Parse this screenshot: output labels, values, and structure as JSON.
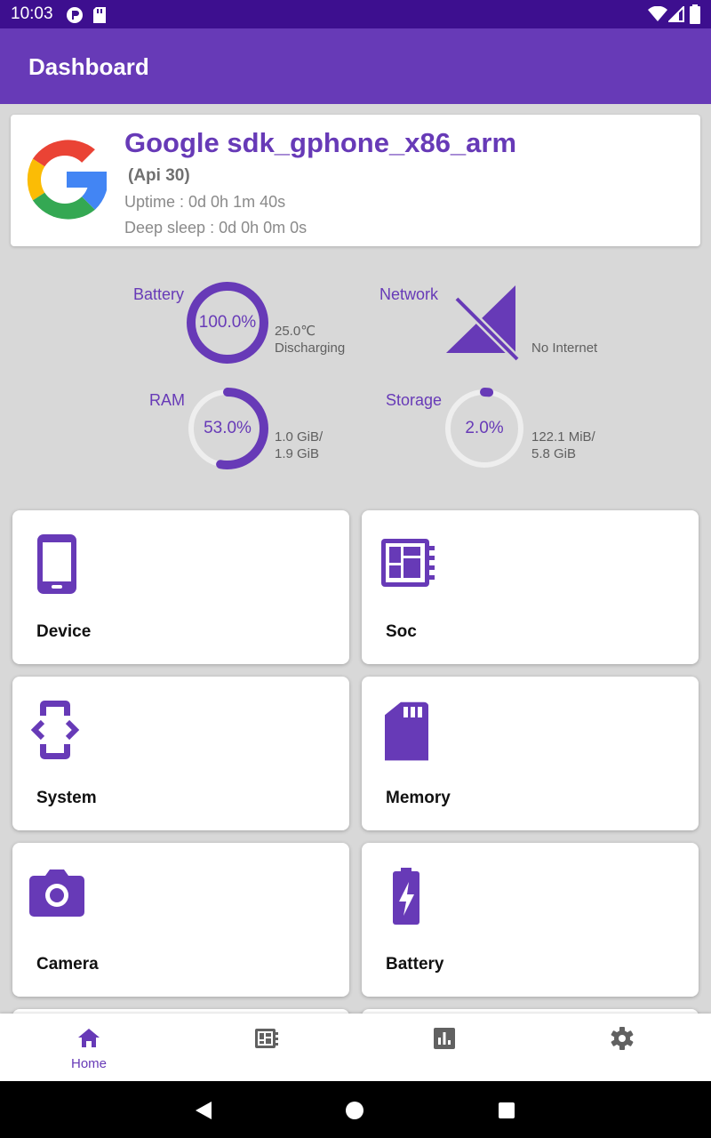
{
  "status_bar": {
    "time": "10:03"
  },
  "app_bar": {
    "title": "Dashboard"
  },
  "device": {
    "name": "Google sdk_gphone_x86_arm",
    "api": "(Api 30)",
    "uptime": "Uptime : 0d 0h 1m 40s",
    "deep_sleep": "Deep sleep : 0d 0h 0m 0s"
  },
  "stats": {
    "battery": {
      "label": "Battery",
      "percent_text": "100.0%",
      "level": 100,
      "temperature": "25.0℃",
      "state": "Discharging"
    },
    "network": {
      "label": "Network",
      "status": "No Internet"
    },
    "ram": {
      "label": "RAM",
      "percent_text": "53.0%",
      "level": 53,
      "used": "1.0 GiB/",
      "total": "1.9 GiB"
    },
    "storage": {
      "label": "Storage",
      "percent_text": "2.0%",
      "level": 2,
      "used": "122.1 MiB/",
      "total": "5.8 GiB"
    }
  },
  "tiles": [
    {
      "label": "Device",
      "icon": "phone-icon"
    },
    {
      "label": "Soc",
      "icon": "chip-icon"
    },
    {
      "label": "System",
      "icon": "developer-mode-icon"
    },
    {
      "label": "Memory",
      "icon": "sd-card-icon"
    },
    {
      "label": "Camera",
      "icon": "camera-icon"
    },
    {
      "label": "Battery",
      "icon": "battery-charging-icon"
    }
  ],
  "bottom_nav": [
    {
      "label": "Home",
      "icon": "home-icon",
      "active": true
    },
    {
      "label": "",
      "icon": "chip-icon",
      "active": false
    },
    {
      "label": "",
      "icon": "bar-chart-icon",
      "active": false
    },
    {
      "label": "",
      "icon": "gear-icon",
      "active": false
    }
  ],
  "colors": {
    "primary": "#673ab7",
    "status_bar": "#3d0f8f",
    "ring_track": "#eeeeee",
    "background": "#d8d8d8"
  }
}
